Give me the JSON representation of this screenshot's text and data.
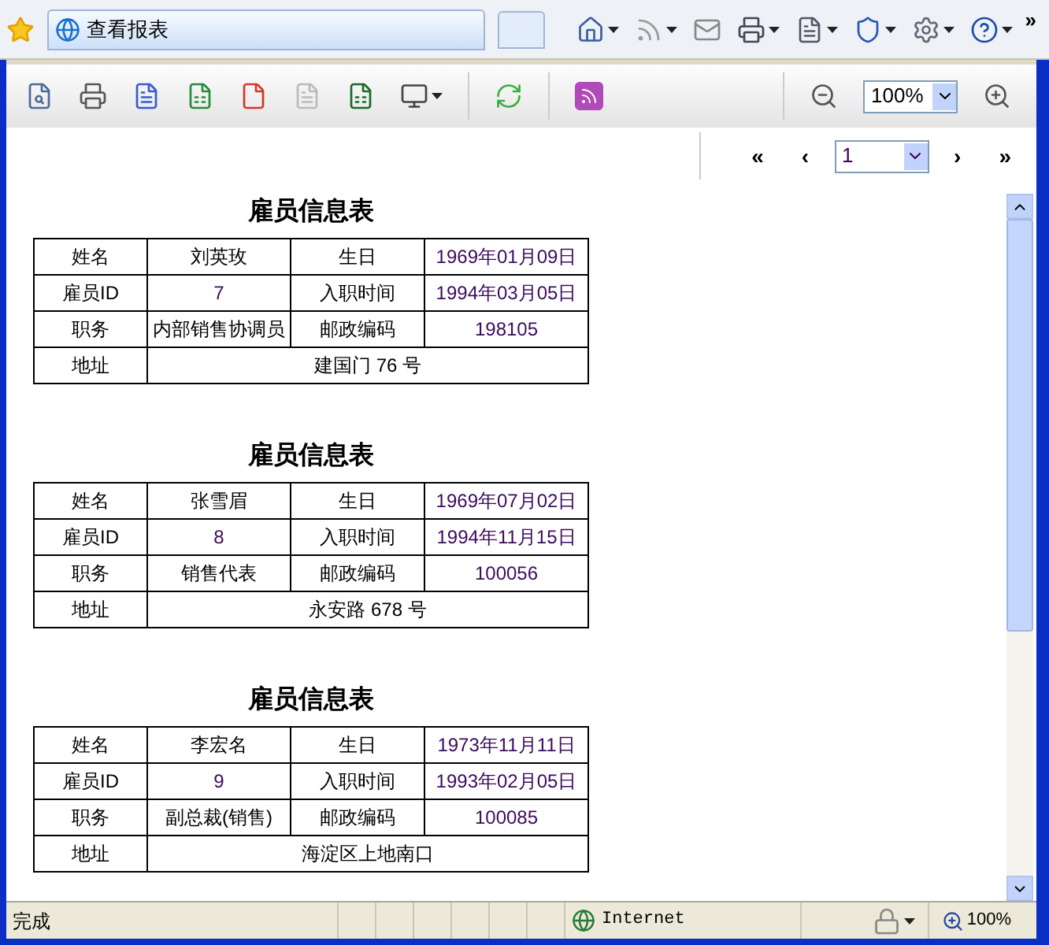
{
  "browser": {
    "tab_title": "查看报表",
    "overflow": "»"
  },
  "toolbar": {
    "zoom": "100%"
  },
  "pager": {
    "first": "«",
    "prev": "‹",
    "page": "1",
    "next": "›",
    "last": "»"
  },
  "reports": [
    {
      "title": "雇员信息表",
      "rows": [
        [
          {
            "text": "姓名",
            "kind": "label"
          },
          {
            "text": "刘英玫",
            "kind": "label"
          },
          {
            "text": "生日",
            "kind": "label"
          },
          {
            "text": "1969年01月09日",
            "kind": "value"
          }
        ],
        [
          {
            "text": "雇员ID",
            "kind": "label"
          },
          {
            "text": "7",
            "kind": "value"
          },
          {
            "text": "入职时间",
            "kind": "label"
          },
          {
            "text": "1994年03月05日",
            "kind": "value"
          }
        ],
        [
          {
            "text": "职务",
            "kind": "label"
          },
          {
            "text": "内部销售协调员",
            "kind": "label"
          },
          {
            "text": "邮政编码",
            "kind": "label"
          },
          {
            "text": "198105",
            "kind": "value"
          }
        ],
        [
          {
            "text": "地址",
            "kind": "label"
          },
          {
            "text": "建国门 76 号",
            "kind": "label",
            "colspan": 3
          }
        ]
      ]
    },
    {
      "title": "雇员信息表",
      "rows": [
        [
          {
            "text": "姓名",
            "kind": "label"
          },
          {
            "text": "张雪眉",
            "kind": "label"
          },
          {
            "text": "生日",
            "kind": "label"
          },
          {
            "text": "1969年07月02日",
            "kind": "value"
          }
        ],
        [
          {
            "text": "雇员ID",
            "kind": "label"
          },
          {
            "text": "8",
            "kind": "value"
          },
          {
            "text": "入职时间",
            "kind": "label"
          },
          {
            "text": "1994年11月15日",
            "kind": "value"
          }
        ],
        [
          {
            "text": "职务",
            "kind": "label"
          },
          {
            "text": "销售代表",
            "kind": "label"
          },
          {
            "text": "邮政编码",
            "kind": "label"
          },
          {
            "text": "100056",
            "kind": "value"
          }
        ],
        [
          {
            "text": "地址",
            "kind": "label"
          },
          {
            "text": "永安路 678 号",
            "kind": "label",
            "colspan": 3
          }
        ]
      ]
    },
    {
      "title": "雇员信息表",
      "rows": [
        [
          {
            "text": "姓名",
            "kind": "label"
          },
          {
            "text": "李宏名",
            "kind": "label"
          },
          {
            "text": "生日",
            "kind": "label"
          },
          {
            "text": "1973年11月11日",
            "kind": "value"
          }
        ],
        [
          {
            "text": "雇员ID",
            "kind": "label"
          },
          {
            "text": "9",
            "kind": "value"
          },
          {
            "text": "入职时间",
            "kind": "label"
          },
          {
            "text": "1993年02月05日",
            "kind": "value"
          }
        ],
        [
          {
            "text": "职务",
            "kind": "label"
          },
          {
            "text": "副总裁(销售)",
            "kind": "label"
          },
          {
            "text": "邮政编码",
            "kind": "label"
          },
          {
            "text": "100085",
            "kind": "value"
          }
        ],
        [
          {
            "text": "地址",
            "kind": "label"
          },
          {
            "text": "海淀区上地南口",
            "kind": "label",
            "colspan": 3
          }
        ]
      ]
    }
  ],
  "status_bar": {
    "text": "完成",
    "zone": "Internet",
    "zoom": "100%"
  }
}
